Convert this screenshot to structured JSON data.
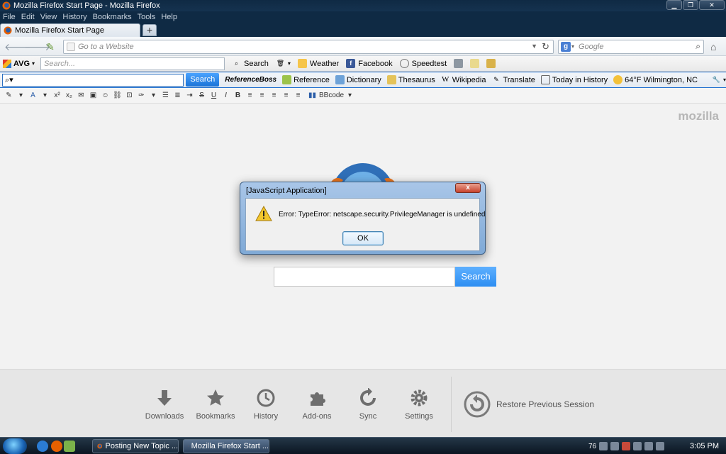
{
  "window": {
    "title": "Mozilla Firefox Start Page - Mozilla Firefox"
  },
  "menu": [
    "File",
    "Edit",
    "View",
    "History",
    "Bookmarks",
    "Tools",
    "Help"
  ],
  "tab": {
    "label": "Mozilla Firefox Start Page",
    "new_tab": "+"
  },
  "nav": {
    "url_placeholder": "Go to a Website",
    "search_placeholder": "Google"
  },
  "avg_toolbar": {
    "brand": "AVG",
    "search_placeholder": "Search...",
    "search_label": "Search",
    "weather": "Weather",
    "facebook": "Facebook",
    "speedtest": "Speedtest"
  },
  "ref_toolbar": {
    "search_button": "Search",
    "brand": "ReferenceBoss",
    "items": [
      "Reference",
      "Dictionary",
      "Thesaurus",
      "Wikipedia",
      "Translate",
      "Today in History",
      "64°F Wilmington, NC"
    ]
  },
  "format_toolbar": {
    "buttons": [
      "A",
      "x²",
      "x₂",
      "U",
      "S",
      "I",
      "B"
    ],
    "bbcode": "BBcode"
  },
  "content": {
    "brand_word": "mozilla",
    "search_button": "Search"
  },
  "launcher": {
    "items": [
      "Downloads",
      "Bookmarks",
      "History",
      "Add-ons",
      "Sync",
      "Settings"
    ],
    "restore": "Restore Previous Session"
  },
  "dialog": {
    "title": "[JavaScript Application]",
    "message": "Error: TypeError: netscape.security.PrivilegeManager is undefined",
    "ok": "OK",
    "close": "x"
  },
  "taskbar": {
    "tasks": [
      "Posting New Topic ...",
      "Mozilla Firefox Start ..."
    ],
    "tray_badge": "76",
    "clock": "3:05 PM"
  },
  "colors": {
    "accent_blue": "#2d8ef2",
    "titlebar": "#0f2a44",
    "dialog_frame": "#7fa9d6"
  }
}
